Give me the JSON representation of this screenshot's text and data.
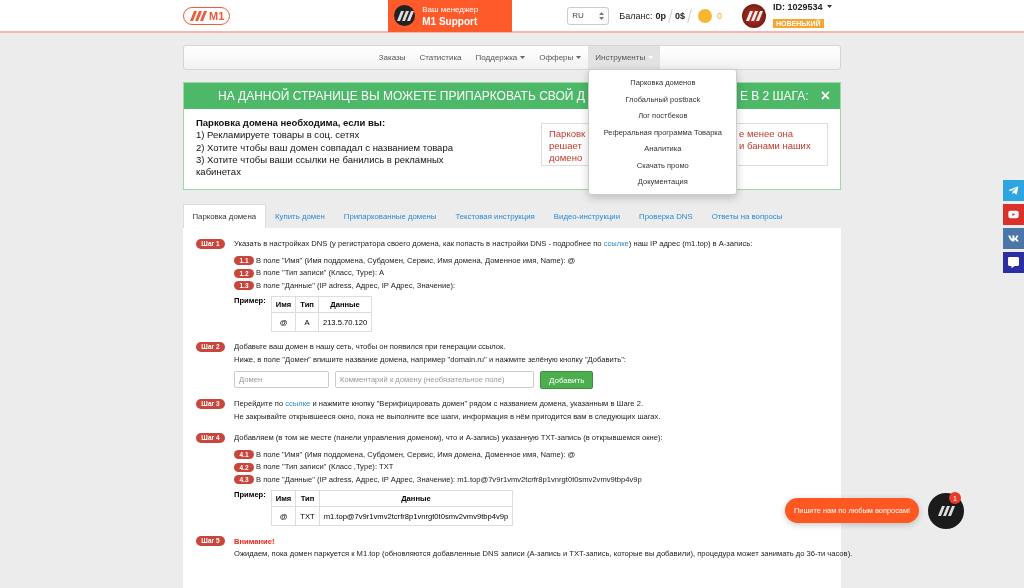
{
  "header": {
    "logo_text": "M1",
    "manager": {
      "caption": "Ваш менеджер",
      "name": "M1 Support"
    },
    "language": "RU",
    "balance_label": "Баланс:",
    "balance_rub": "0р",
    "balance_usd": "0$",
    "coins": "0",
    "user_id": "ID: 1029534",
    "user_level": "НОВЕНЬКИЙ"
  },
  "nav": [
    {
      "label": "Заказы",
      "dropdown": false,
      "selected": false
    },
    {
      "label": "Статистика",
      "dropdown": false,
      "selected": false
    },
    {
      "label": "Поддержка",
      "dropdown": true,
      "selected": false
    },
    {
      "label": "Офферы",
      "dropdown": true,
      "selected": false
    },
    {
      "label": "Инструменты",
      "dropdown": true,
      "selected": true
    }
  ],
  "tools_menu": [
    "Парковка доменов",
    "Глобальный postback",
    "Лог постбеков",
    "Реферальная программа Товарка",
    "Аналитика",
    "Скачать промо",
    "Документация"
  ],
  "banner": {
    "title_left": "НА ДАННОЙ СТРАНИЦЕ ВЫ МОЖЕТЕ ПРИПАРКОВАТЬ СВОЙ Д",
    "title_right": "Е В 2 ШАГА:",
    "close": "×",
    "intro_title": "Парковка домена необходима, если вы:",
    "reasons": [
      "1) Рекламируете товары в соц. сетях",
      "2) Хотите чтобы ваш домен совпадал с названием товара",
      "3) Хотите чтобы ваши ссылки не банились в рекламных кабинетах"
    ],
    "notice_rows": [
      {
        "left": "Парковк",
        "right": "е менее она"
      },
      {
        "left": "решает",
        "right": "и банами наших"
      },
      {
        "left": "домено"
      }
    ]
  },
  "tabs": [
    {
      "label": "Парковка домена",
      "selected": true
    },
    {
      "label": "Купить домен",
      "selected": false
    },
    {
      "label": "Припаркованные домены",
      "selected": false
    },
    {
      "label": "Текстовая инструкция",
      "selected": false
    },
    {
      "label": "Видео-инструкции",
      "selected": false
    },
    {
      "label": "Проверка DNS",
      "selected": false
    },
    {
      "label": "Ответы на вопросы",
      "selected": false
    }
  ],
  "steps": [
    {
      "badge": "Шаг 1",
      "lines": [
        {
          "text": "Указать в настройках DNS (у регистратора своего домена, как попасть в настройки DNS - подробнее по ",
          "link": "ссылке",
          "after": ") наш IP адрес (m1.top) в А-запись:"
        }
      ],
      "substeps": [
        {
          "badge": "1.1",
          "text": "В поле \"Имя\" (Имя поддомена, Субдомен, Сервис, Имя домена, Доменное имя, Name): @"
        },
        {
          "badge": "1.2",
          "text": "В поле \"Тип записи\" (Класс, Type): A"
        },
        {
          "badge": "1.3",
          "text": "В поле \"Данные\" (IP adress, Адрес, IP Адрес, Значение):"
        }
      ],
      "example": {
        "label": "Пример:",
        "columns": [
          "Имя",
          "Тип",
          "Данные"
        ],
        "row": [
          "@",
          "A",
          "213.5.70.120"
        ]
      }
    },
    {
      "badge": "Шаг 2",
      "lines": [
        {
          "text": "Добавьте ваш домен в нашу сеть, чтобы он появился при генерации ссылок."
        },
        {
          "text": "Ниже, в поле \"Домен\" впишите название домена, например \"domain.ru\" и нажмите зелёную кнопку \"Добавить\":"
        }
      ],
      "form": {
        "domain_placeholder": "Домен",
        "comment_placeholder": "Комментарий к домену (необязательное поле)",
        "button": "Добавить"
      }
    },
    {
      "badge": "Шаг 3",
      "lines": [
        {
          "text": "Перейдите по ",
          "link": "ссылке",
          "after": " и нажмите кнопку \"Верифицировать домен\" рядом с названием домена, указанным в Шаге 2."
        },
        {
          "text": "Не закрывайте открывшееся окно, пока не выполните все шаги, информация в нём пригодится вам в следующих шагах."
        }
      ]
    },
    {
      "badge": "Шаг 4",
      "lines": [
        {
          "text": "Добавляем (в том же месте (панели управления доменом), что и А-запись) указанную TXT-запись (в открывшемся окне):"
        }
      ],
      "substeps": [
        {
          "badge": "4.1",
          "text": "В поле \"Имя\" (Имя поддомена, Субдомен, Сервис, Имя домена, Доменное имя, Name): @"
        },
        {
          "badge": "4.2",
          "text": "В поле \"Тип записи\" (Класс ,Type): TXT"
        },
        {
          "badge": "4.3",
          "text": "В поле \"Данные\" (IP adress, Адрес, IP Адрес, Значение): m1.top@7v9r1vmv2tcrfr8p1vnrgt0t0smv2vmv9tbp4v9p"
        }
      ],
      "example": {
        "label": "Пример:",
        "columns": [
          "Имя",
          "Тип",
          "Данные"
        ],
        "row": [
          "@",
          "TXT",
          "m1.top@7v9r1vmv2tcrfr8p1vnrgt0t0smv2vmv9tbp4v9p"
        ]
      }
    },
    {
      "badge": "Шаг 5",
      "warning": "Внимание!",
      "lines": [
        {
          "text": "Ожидаем, пока домен паркуется к M1.top (обновляются добавленные DNS записи (А-запись и TXT-запись, которые вы добавили), процедура может занимать до 36-ти часов)."
        }
      ]
    }
  ],
  "chat": {
    "prompt": "Пишите нам по любым вопросам!",
    "unread": "1"
  }
}
